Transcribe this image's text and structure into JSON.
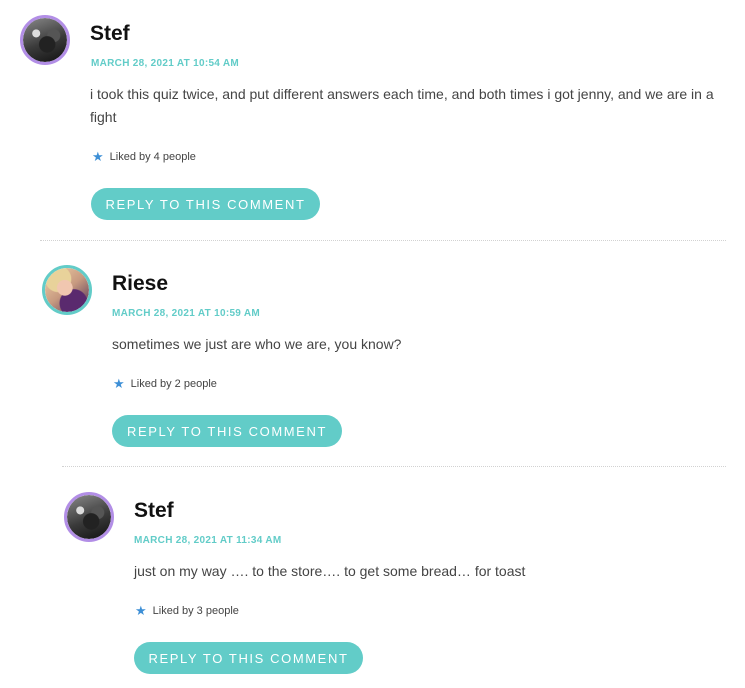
{
  "comments": [
    {
      "author": "Stef",
      "date": "MARCH 28, 2021 AT 10:54 AM",
      "text": "i took this quiz twice, and put different answers each time, and both times i got jenny, and we are in a fight",
      "likes": "Liked by 4 people",
      "reply_label": "REPLY TO THIS COMMENT",
      "avatar_ring_color": "#b28ee6"
    },
    {
      "author": "Riese",
      "date": "MARCH 28, 2021 AT 10:59 AM",
      "text": "sometimes we just are who we are, you know?",
      "likes": "Liked by 2 people",
      "reply_label": "REPLY TO THIS COMMENT",
      "avatar_ring_color": "#62ccc8"
    },
    {
      "author": "Stef",
      "date": "MARCH 28, 2021 AT 11:34 AM",
      "text": "just on my way …. to the store…. to get some bread… for toast",
      "likes": "Liked by 3 people",
      "reply_label": "REPLY TO THIS COMMENT",
      "avatar_ring_color": "#b28ee6"
    }
  ],
  "colors": {
    "accent": "#62ccc8",
    "star": "#3d8fd6",
    "author": "#111111",
    "body_text": "#444444"
  },
  "icons": {
    "like": "star-icon"
  }
}
